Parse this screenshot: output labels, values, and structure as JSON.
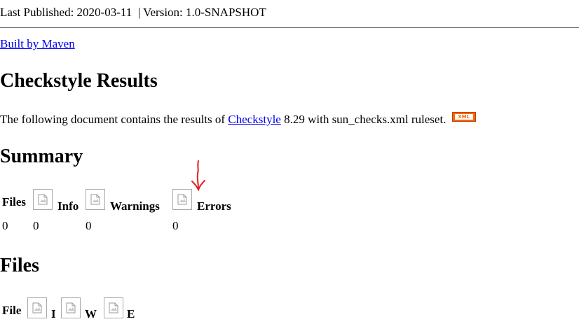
{
  "header": {
    "last_published": "Last Published: 2020-03-11",
    "separator": "  | ",
    "version": "Version: 1.0-SNAPSHOT"
  },
  "built_by_link": "Built by Maven",
  "results": {
    "title": "Checkstyle Results",
    "intro_prefix": "The following document contains the results of ",
    "checkstyle_link": "Checkstyle",
    "intro_suffix": " 8.29 with sun_checks.xml ruleset.",
    "xml_badge": "XML"
  },
  "summary": {
    "title": "Summary",
    "headers": [
      "Files",
      "Info",
      "Warnings",
      "Errors"
    ],
    "values": [
      "0",
      "0",
      "0",
      "0"
    ]
  },
  "files": {
    "title": "Files",
    "headers": [
      "File",
      "I",
      "W",
      "E"
    ]
  },
  "icons": {
    "broken_image": "broken-image-icon",
    "annotation_arrow": "red-arrow-icon"
  },
  "colors": {
    "link": "#0000ee",
    "xml_badge": "#ff6600",
    "annotation": "#e02020"
  }
}
